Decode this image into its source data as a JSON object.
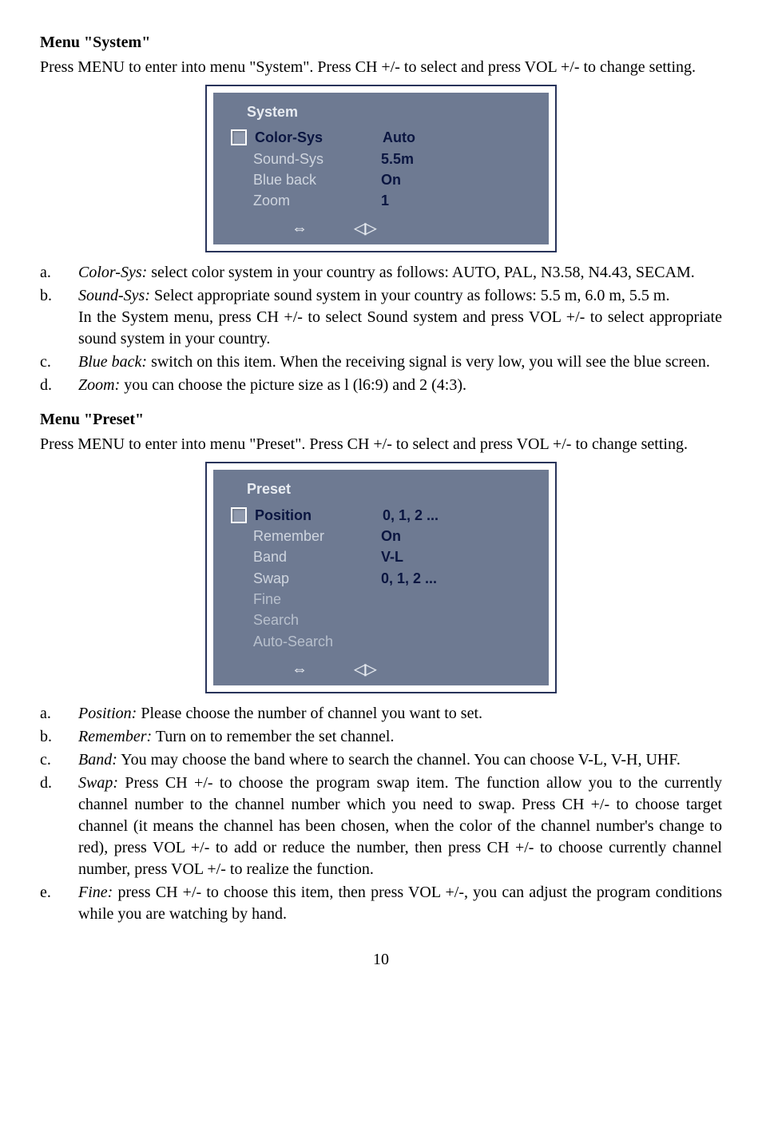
{
  "menu_system": {
    "heading": "Menu \"System\"",
    "intro": "Press MENU to enter into menu \"System\". Press CH +/- to select and press VOL +/- to change setting.",
    "panel_title": "System",
    "rows": [
      {
        "label": "Color-Sys",
        "value": "Auto",
        "selected": true
      },
      {
        "label": "Sound-Sys",
        "value": "5.5m"
      },
      {
        "label": "Blue back",
        "value": "On"
      },
      {
        "label": "Zoom",
        "value": "1"
      }
    ],
    "nav_left": "⇔",
    "nav_right": "◁▷",
    "items": {
      "a": {
        "mk": "a.",
        "term": "Color-Sys:",
        "text": " select color system in your country as follows: AUTO, PAL, N3.58, N4.43, SECAM."
      },
      "b": {
        "mk": "b.",
        "term": "Sound-Sys:",
        "text": " Select appropriate sound system in your country as follows: 5.5 m, 6.0 m, 5.5 m.",
        "sub": "In the System menu, press CH +/- to select Sound system and press VOL +/- to select appropriate sound system in your country."
      },
      "c": {
        "mk": "c.",
        "term": "Blue back:",
        "text": " switch on this item. When the receiving signal is very low, you will see the blue screen."
      },
      "d": {
        "mk": "d.",
        "term": "Zoom:",
        "text": " you can choose the picture size as l (l6:9) and 2 (4:3)."
      }
    }
  },
  "menu_preset": {
    "heading": "Menu \"Preset\"",
    "intro": "Press MENU to enter into menu \"Preset\". Press CH +/- to select and press VOL +/- to change setting.",
    "panel_title": "Preset",
    "rows": [
      {
        "label": "Position",
        "value": "0, 1, 2 ...",
        "selected": true
      },
      {
        "label": "Remember",
        "value": "On"
      },
      {
        "label": "Band",
        "value": "V-L"
      },
      {
        "label": "Swap",
        "value": "0, 1, 2 ..."
      },
      {
        "label": "Fine",
        "value": ""
      },
      {
        "label": "Search",
        "value": ""
      },
      {
        "label": "Auto-Search",
        "value": ""
      }
    ],
    "nav_left": "⇔",
    "nav_right": "◁▷",
    "items": {
      "a": {
        "mk": "a.",
        "term": "Position:",
        "text": " Please choose the number of channel you want to set."
      },
      "b": {
        "mk": "b.",
        "term": "Remember:",
        "text": " Turn on to remember the set channel."
      },
      "c": {
        "mk": "c.",
        "term": "Band:",
        "text": " You may choose the band where to search the channel. You can choose V-L, V-H, UHF."
      },
      "d": {
        "mk": "d.",
        "term": "Swap:",
        "text": " Press CH +/- to choose the program swap item. The function allow you to the currently channel number to the channel number which you need to swap. Press CH +/- to choose target channel (it means the channel has been chosen, when the color of the channel number's change to red), press VOL +/- to add or reduce the number, then press CH +/- to choose currently channel number, press VOL +/- to realize the function."
      },
      "e": {
        "mk": "e.",
        "term": "Fine:",
        "text": " press CH +/- to choose this item, then press VOL +/-, you can adjust the program conditions while you are watching by hand."
      }
    }
  },
  "page_number": "10"
}
